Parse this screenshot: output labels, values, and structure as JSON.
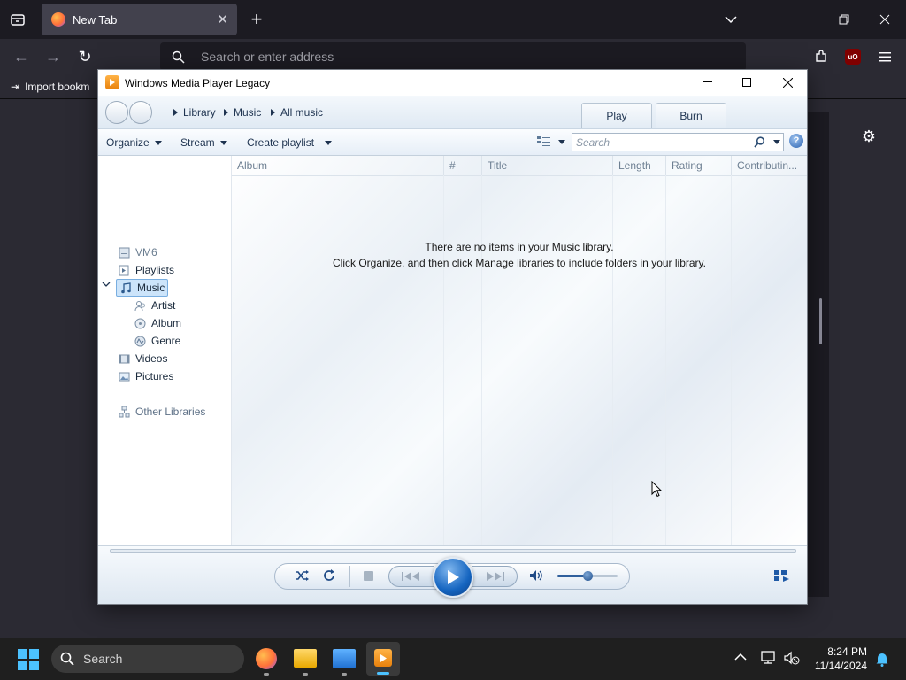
{
  "browser": {
    "tab_title": "New Tab",
    "url_placeholder": "Search or enter address",
    "bookmark_label": "Import bookm",
    "ublock_badge": "uO"
  },
  "wmp": {
    "window_title": "Windows Media Player Legacy",
    "breadcrumb": [
      "Library",
      "Music",
      "All music"
    ],
    "tabs": {
      "play": "Play",
      "burn": "Burn"
    },
    "toolbar": {
      "organize": "Organize",
      "stream": "Stream",
      "create_playlist": "Create playlist",
      "search_placeholder": "Search"
    },
    "nav": {
      "user": "VM6",
      "playlists": "Playlists",
      "music": "Music",
      "artist": "Artist",
      "album": "Album",
      "genre": "Genre",
      "videos": "Videos",
      "pictures": "Pictures",
      "other_libraries": "Other Libraries"
    },
    "columns": [
      "Album",
      "#",
      "Title",
      "Length",
      "Rating",
      "Contributin..."
    ],
    "empty_line1": "There are no items in your Music library.",
    "empty_line2": "Click Organize, and then click Manage libraries to include folders in your library.",
    "volume_level": 0.5,
    "accent_color": "#1565c0"
  },
  "taskbar": {
    "search_label": "Search",
    "time": "8:24 PM",
    "date": "11/14/2024"
  }
}
